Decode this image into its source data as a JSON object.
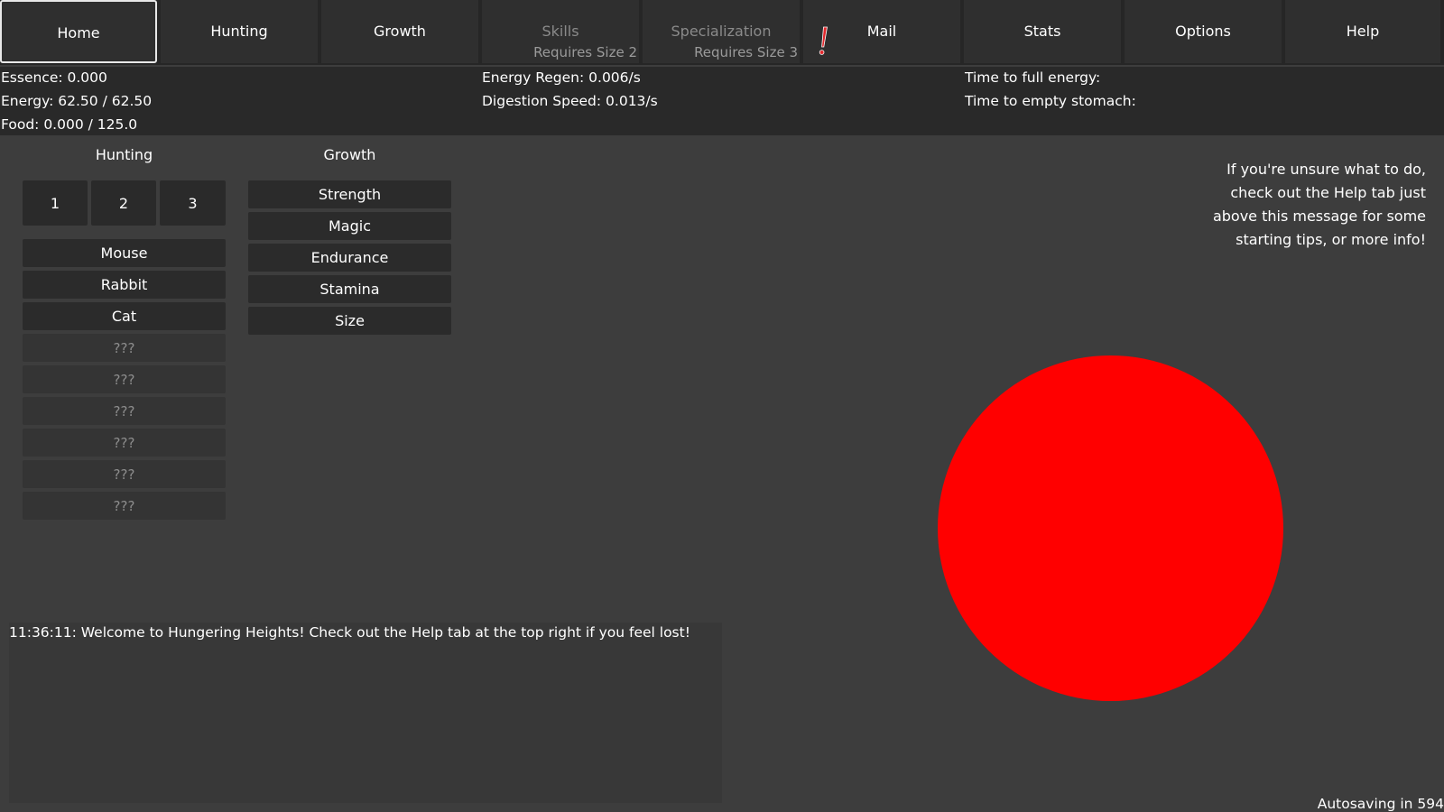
{
  "nav": {
    "tabs": [
      {
        "label": "Home",
        "active": true,
        "disabled": false,
        "sub": ""
      },
      {
        "label": "Hunting",
        "active": false,
        "disabled": false,
        "sub": ""
      },
      {
        "label": "Growth",
        "active": false,
        "disabled": false,
        "sub": ""
      },
      {
        "label": "Skills",
        "active": false,
        "disabled": true,
        "sub": "Requires Size 2"
      },
      {
        "label": "Specialization",
        "active": false,
        "disabled": true,
        "sub": "Requires Size 3"
      },
      {
        "label": "Mail",
        "active": false,
        "disabled": false,
        "sub": ""
      },
      {
        "label": "Stats",
        "active": false,
        "disabled": false,
        "sub": ""
      },
      {
        "label": "Options",
        "active": false,
        "disabled": false,
        "sub": ""
      },
      {
        "label": "Help",
        "active": false,
        "disabled": false,
        "sub": ""
      }
    ],
    "mail_notification_icon": "exclamation-icon"
  },
  "stats": {
    "essence": "Essence: 0.000",
    "energy": "Energy: 62.50 / 62.50",
    "food": "Food: 0.000 / 125.0",
    "energy_regen": "Energy Regen: 0.006/s",
    "digestion_speed": "Digestion Speed: 0.013/s",
    "time_to_full_energy": "Time to full energy:",
    "time_to_empty_stomach": "Time to empty stomach:"
  },
  "hunting": {
    "title": "Hunting",
    "multipliers": [
      "1",
      "2",
      "3"
    ],
    "prey": [
      "Mouse",
      "Rabbit",
      "Cat"
    ],
    "locked": [
      "???",
      "???",
      "???",
      "???",
      "???",
      "???"
    ]
  },
  "growth": {
    "title": "Growth",
    "items": [
      "Strength",
      "Magic",
      "Endurance",
      "Stamina",
      "Size"
    ]
  },
  "help_message": "If you're unsure what to do, check out the Help tab just above this message for some starting tips, or more info!",
  "log": {
    "entries": [
      "11:36:11: Welcome to Hungering Heights! Check out the Help tab at the top right if you feel lost!"
    ]
  },
  "autosave": "Autosaving in 594",
  "colors": {
    "orb": "#ff0000",
    "notification": "#e2282c"
  }
}
